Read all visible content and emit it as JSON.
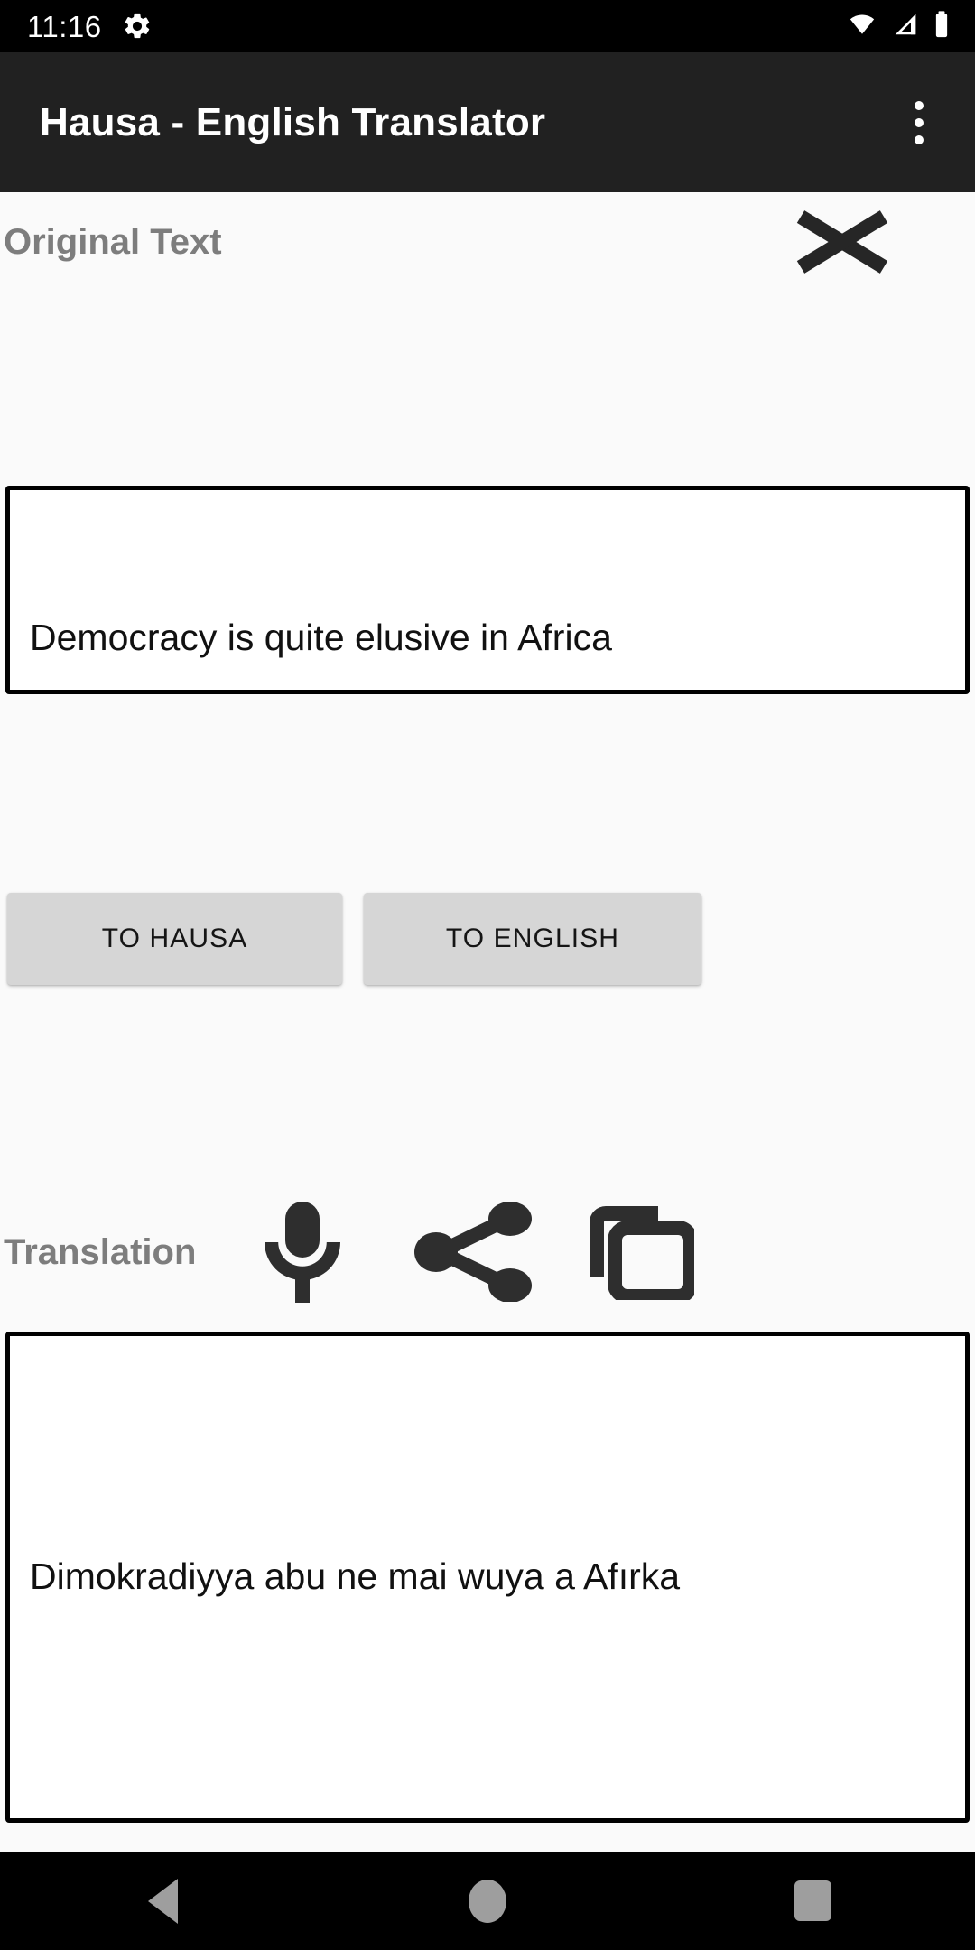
{
  "status_bar": {
    "time": "11:16",
    "icons": [
      "gear-icon",
      "wifi-icon",
      "cellular-signal-icon",
      "battery-icon"
    ],
    "background_color": "#000000",
    "foreground_color": "#ffffff"
  },
  "app_bar": {
    "title": "Hausa - English Translator",
    "overflow_menu_label": "More options",
    "background_color": "#212121",
    "title_color": "#ffffff"
  },
  "source_section": {
    "label": "Original Text",
    "clear_button_label": "Clear",
    "clear_icon": "close-x-icon",
    "input_value": "Democracy is quite elusive in Africa",
    "input_placeholder": "",
    "label_color": "#7d7d7d"
  },
  "actions": {
    "to_hausa_label": "TO HAUSA",
    "to_english_label": "TO ENGLISH",
    "button_color": "#d6d6d6",
    "button_text_color": "#151515"
  },
  "translation_section": {
    "label": "Translation",
    "speak_icon": "microphone-icon",
    "share_icon": "share-icon",
    "copy_icon": "copy-icon",
    "speak_label": "Speak",
    "share_label": "Share",
    "copy_label": "Copy",
    "output_value": "Dimokradiyya abu ne mai wuya a Afırka",
    "output_placeholder": "",
    "label_color": "#7d7d7d"
  },
  "nav_bar": {
    "back_label": "Back",
    "home_label": "Home",
    "recents_label": "Recents",
    "background_color": "#000000",
    "icon_color": "#9e9e9e"
  }
}
